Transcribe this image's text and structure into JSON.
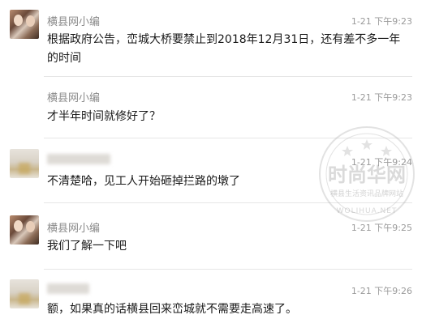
{
  "messages": [
    {
      "sender": "横县网小编",
      "time": "1-21 下午9:23",
      "text": "根据政府公告，峦城大桥要禁止到2018年12月31日，还有差不多一年的时间",
      "avatar": "couple-photo-avatar"
    },
    {
      "sender": "横县网小编",
      "time": "1-21 下午9:23",
      "text": "才半年时间就修好了？",
      "avatar": "none"
    },
    {
      "sender": "",
      "time": "1-21 下午9:24",
      "text": "不清楚哈，见工人开始砸掉拦路的墩了",
      "avatar": "blurred-avatar"
    },
    {
      "sender": "横县网小编",
      "time": "1-21 下午9:25",
      "text": "我们了解一下吧",
      "avatar": "couple-photo-avatar"
    },
    {
      "sender": "",
      "time": "1-21 下午9:26",
      "text": "额，如果真的话横县回来峦城就不需要走高速了。",
      "avatar": "blurred-avatar"
    }
  ],
  "watermark": {
    "main_text": "时尚华网",
    "sub_text": "横县生活资讯品牌网站",
    "url": "WOLIHUA.NET"
  }
}
